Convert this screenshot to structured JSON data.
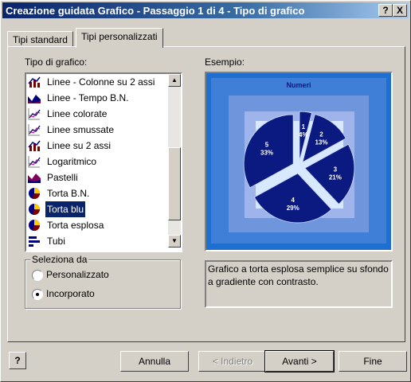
{
  "window": {
    "title": "Creazione guidata Grafico - Passaggio 1 di 4 - Tipo di grafico",
    "help_btn": "?",
    "close_btn": "X"
  },
  "tabs": [
    {
      "label": "Tipi standard",
      "active": false
    },
    {
      "label": "Tipi personalizzati",
      "active": true
    }
  ],
  "chart_type_list": {
    "label": "Tipo di grafico:",
    "items": [
      {
        "label": "Linee - Colonne su 2 assi",
        "icon": "line-column-icon"
      },
      {
        "label": "Linee - Tempo B.N.",
        "icon": "area-bw-icon"
      },
      {
        "label": "Linee colorate",
        "icon": "line-icon"
      },
      {
        "label": "Linee smussate",
        "icon": "line-icon"
      },
      {
        "label": "Linee su 2 assi",
        "icon": "line-column-icon"
      },
      {
        "label": "Logaritmico",
        "icon": "line-icon"
      },
      {
        "label": "Pastelli",
        "icon": "area-icon"
      },
      {
        "label": "Torta B.N.",
        "icon": "pie-icon"
      },
      {
        "label": "Torta blu",
        "icon": "pie-icon",
        "selected": true
      },
      {
        "label": "Torta esplosa",
        "icon": "pie-icon"
      },
      {
        "label": "Tubi",
        "icon": "bar-icon"
      }
    ]
  },
  "select_from": {
    "legend": "Seleziona da",
    "options": [
      {
        "label": "Personalizzato",
        "checked": false
      },
      {
        "label": "Incorporato",
        "checked": true
      }
    ]
  },
  "example": {
    "label": "Esempio:",
    "description": "Grafico a torta esplosa semplice su sfondo a gradiente con contrasto."
  },
  "buttons": {
    "help": "?",
    "cancel": "Annulla",
    "back": "< Indietro",
    "next": "Avanti >",
    "finish": "Fine"
  },
  "chart_data": {
    "type": "pie",
    "title": "Numeri",
    "categories": [
      "1",
      "2",
      "3",
      "4",
      "5"
    ],
    "values": [
      4,
      13,
      21,
      29,
      33
    ],
    "labels": [
      "4%",
      "13%",
      "21%",
      "29%",
      "33%"
    ],
    "exploded": true,
    "colors": {
      "slice": "#0a1a80",
      "plot_bg": "#a8c8f0",
      "outer_bg": "#1f6fd0"
    }
  }
}
